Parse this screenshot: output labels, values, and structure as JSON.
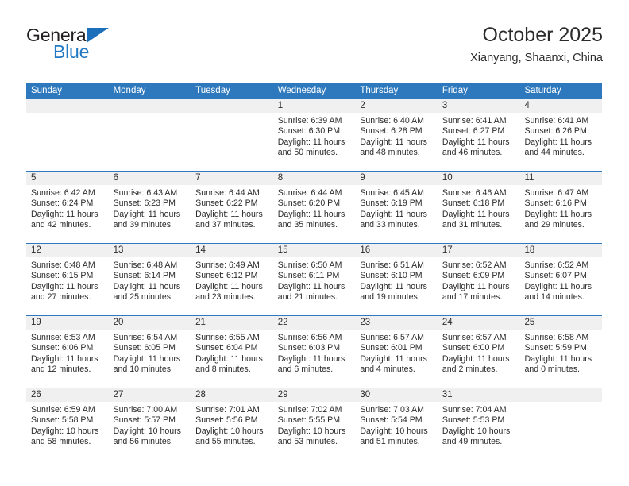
{
  "brand": {
    "line1": "General",
    "line2": "Blue",
    "triangle_color": "#1b6fbb",
    "text_color": "#231f20",
    "accent_color": "#2279c3"
  },
  "header": {
    "title": "October 2025",
    "subtitle": "Xianyang, Shaanxi, China"
  },
  "theme": {
    "header_bg": "#2e79bd",
    "header_text": "#ffffff",
    "daynum_bg": "#f0f0f0",
    "cell_bg": "#ffffff",
    "text": "#2b2b2b",
    "week_divider": "#2e79bd"
  },
  "weekdays": [
    "Sunday",
    "Monday",
    "Tuesday",
    "Wednesday",
    "Thursday",
    "Friday",
    "Saturday"
  ],
  "weeks": [
    [
      {
        "day": "",
        "lines": []
      },
      {
        "day": "",
        "lines": []
      },
      {
        "day": "",
        "lines": []
      },
      {
        "day": "1",
        "lines": [
          "Sunrise: 6:39 AM",
          "Sunset: 6:30 PM",
          "Daylight: 11 hours",
          "and 50 minutes."
        ]
      },
      {
        "day": "2",
        "lines": [
          "Sunrise: 6:40 AM",
          "Sunset: 6:28 PM",
          "Daylight: 11 hours",
          "and 48 minutes."
        ]
      },
      {
        "day": "3",
        "lines": [
          "Sunrise: 6:41 AM",
          "Sunset: 6:27 PM",
          "Daylight: 11 hours",
          "and 46 minutes."
        ]
      },
      {
        "day": "4",
        "lines": [
          "Sunrise: 6:41 AM",
          "Sunset: 6:26 PM",
          "Daylight: 11 hours",
          "and 44 minutes."
        ]
      }
    ],
    [
      {
        "day": "5",
        "lines": [
          "Sunrise: 6:42 AM",
          "Sunset: 6:24 PM",
          "Daylight: 11 hours",
          "and 42 minutes."
        ]
      },
      {
        "day": "6",
        "lines": [
          "Sunrise: 6:43 AM",
          "Sunset: 6:23 PM",
          "Daylight: 11 hours",
          "and 39 minutes."
        ]
      },
      {
        "day": "7",
        "lines": [
          "Sunrise: 6:44 AM",
          "Sunset: 6:22 PM",
          "Daylight: 11 hours",
          "and 37 minutes."
        ]
      },
      {
        "day": "8",
        "lines": [
          "Sunrise: 6:44 AM",
          "Sunset: 6:20 PM",
          "Daylight: 11 hours",
          "and 35 minutes."
        ]
      },
      {
        "day": "9",
        "lines": [
          "Sunrise: 6:45 AM",
          "Sunset: 6:19 PM",
          "Daylight: 11 hours",
          "and 33 minutes."
        ]
      },
      {
        "day": "10",
        "lines": [
          "Sunrise: 6:46 AM",
          "Sunset: 6:18 PM",
          "Daylight: 11 hours",
          "and 31 minutes."
        ]
      },
      {
        "day": "11",
        "lines": [
          "Sunrise: 6:47 AM",
          "Sunset: 6:16 PM",
          "Daylight: 11 hours",
          "and 29 minutes."
        ]
      }
    ],
    [
      {
        "day": "12",
        "lines": [
          "Sunrise: 6:48 AM",
          "Sunset: 6:15 PM",
          "Daylight: 11 hours",
          "and 27 minutes."
        ]
      },
      {
        "day": "13",
        "lines": [
          "Sunrise: 6:48 AM",
          "Sunset: 6:14 PM",
          "Daylight: 11 hours",
          "and 25 minutes."
        ]
      },
      {
        "day": "14",
        "lines": [
          "Sunrise: 6:49 AM",
          "Sunset: 6:12 PM",
          "Daylight: 11 hours",
          "and 23 minutes."
        ]
      },
      {
        "day": "15",
        "lines": [
          "Sunrise: 6:50 AM",
          "Sunset: 6:11 PM",
          "Daylight: 11 hours",
          "and 21 minutes."
        ]
      },
      {
        "day": "16",
        "lines": [
          "Sunrise: 6:51 AM",
          "Sunset: 6:10 PM",
          "Daylight: 11 hours",
          "and 19 minutes."
        ]
      },
      {
        "day": "17",
        "lines": [
          "Sunrise: 6:52 AM",
          "Sunset: 6:09 PM",
          "Daylight: 11 hours",
          "and 17 minutes."
        ]
      },
      {
        "day": "18",
        "lines": [
          "Sunrise: 6:52 AM",
          "Sunset: 6:07 PM",
          "Daylight: 11 hours",
          "and 14 minutes."
        ]
      }
    ],
    [
      {
        "day": "19",
        "lines": [
          "Sunrise: 6:53 AM",
          "Sunset: 6:06 PM",
          "Daylight: 11 hours",
          "and 12 minutes."
        ]
      },
      {
        "day": "20",
        "lines": [
          "Sunrise: 6:54 AM",
          "Sunset: 6:05 PM",
          "Daylight: 11 hours",
          "and 10 minutes."
        ]
      },
      {
        "day": "21",
        "lines": [
          "Sunrise: 6:55 AM",
          "Sunset: 6:04 PM",
          "Daylight: 11 hours",
          "and 8 minutes."
        ]
      },
      {
        "day": "22",
        "lines": [
          "Sunrise: 6:56 AM",
          "Sunset: 6:03 PM",
          "Daylight: 11 hours",
          "and 6 minutes."
        ]
      },
      {
        "day": "23",
        "lines": [
          "Sunrise: 6:57 AM",
          "Sunset: 6:01 PM",
          "Daylight: 11 hours",
          "and 4 minutes."
        ]
      },
      {
        "day": "24",
        "lines": [
          "Sunrise: 6:57 AM",
          "Sunset: 6:00 PM",
          "Daylight: 11 hours",
          "and 2 minutes."
        ]
      },
      {
        "day": "25",
        "lines": [
          "Sunrise: 6:58 AM",
          "Sunset: 5:59 PM",
          "Daylight: 11 hours",
          "and 0 minutes."
        ]
      }
    ],
    [
      {
        "day": "26",
        "lines": [
          "Sunrise: 6:59 AM",
          "Sunset: 5:58 PM",
          "Daylight: 10 hours",
          "and 58 minutes."
        ]
      },
      {
        "day": "27",
        "lines": [
          "Sunrise: 7:00 AM",
          "Sunset: 5:57 PM",
          "Daylight: 10 hours",
          "and 56 minutes."
        ]
      },
      {
        "day": "28",
        "lines": [
          "Sunrise: 7:01 AM",
          "Sunset: 5:56 PM",
          "Daylight: 10 hours",
          "and 55 minutes."
        ]
      },
      {
        "day": "29",
        "lines": [
          "Sunrise: 7:02 AM",
          "Sunset: 5:55 PM",
          "Daylight: 10 hours",
          "and 53 minutes."
        ]
      },
      {
        "day": "30",
        "lines": [
          "Sunrise: 7:03 AM",
          "Sunset: 5:54 PM",
          "Daylight: 10 hours",
          "and 51 minutes."
        ]
      },
      {
        "day": "31",
        "lines": [
          "Sunrise: 7:04 AM",
          "Sunset: 5:53 PM",
          "Daylight: 10 hours",
          "and 49 minutes."
        ]
      },
      {
        "day": "",
        "lines": []
      }
    ]
  ]
}
